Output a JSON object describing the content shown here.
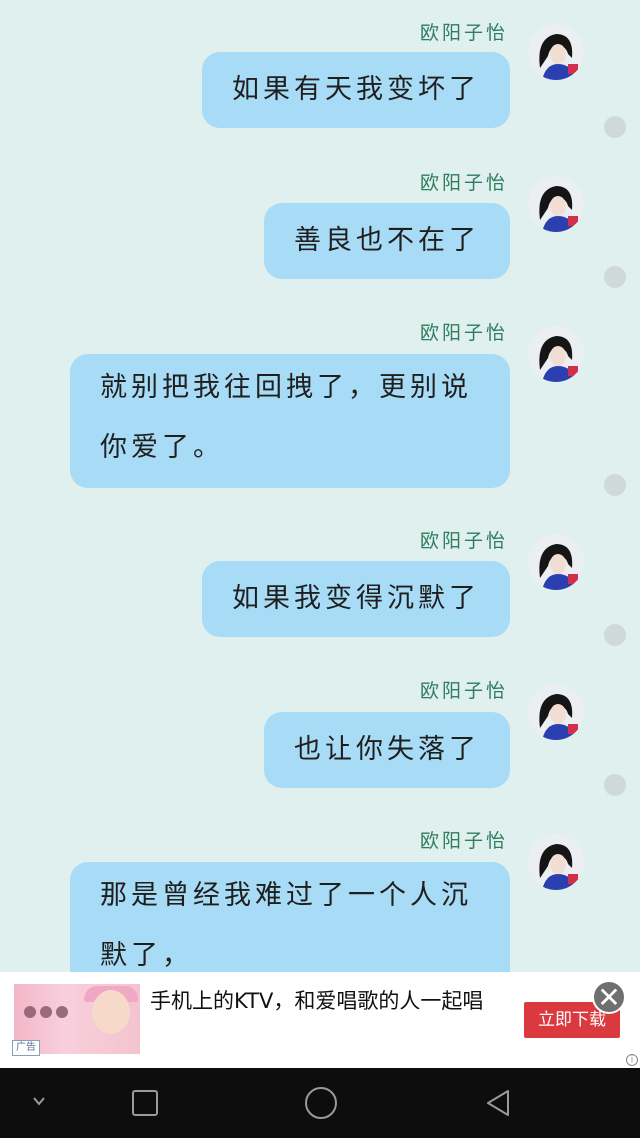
{
  "messages": [
    {
      "sender": "欧阳子怡",
      "text": "如果有天我变坏了"
    },
    {
      "sender": "欧阳子怡",
      "text": "善良也不在了"
    },
    {
      "sender": "欧阳子怡",
      "text": "就别把我往回拽了，更别说你爱了。"
    },
    {
      "sender": "欧阳子怡",
      "text": "如果我变得沉默了"
    },
    {
      "sender": "欧阳子怡",
      "text": "也让你失落了"
    },
    {
      "sender": "欧阳子怡",
      "text": "那是曾经我难过了一个人沉默了，"
    }
  ],
  "ad": {
    "headline": "手机上的KTV，和爱唱歌的人一起唱",
    "button_label": "立即下载",
    "tag": "广告",
    "close_glyph": "✕",
    "info_glyph": "i"
  },
  "colors": {
    "background": "#dff0ee",
    "bubble": "#a8dcf6",
    "sender_name": "#2e7d5c",
    "ad_button": "#d9393f",
    "navbar": "#0d0d0d"
  },
  "icons": {
    "avatar": "avatar-girl-icon",
    "nav": [
      "chevron-down-icon",
      "recent-apps-icon",
      "home-icon",
      "back-icon"
    ]
  }
}
